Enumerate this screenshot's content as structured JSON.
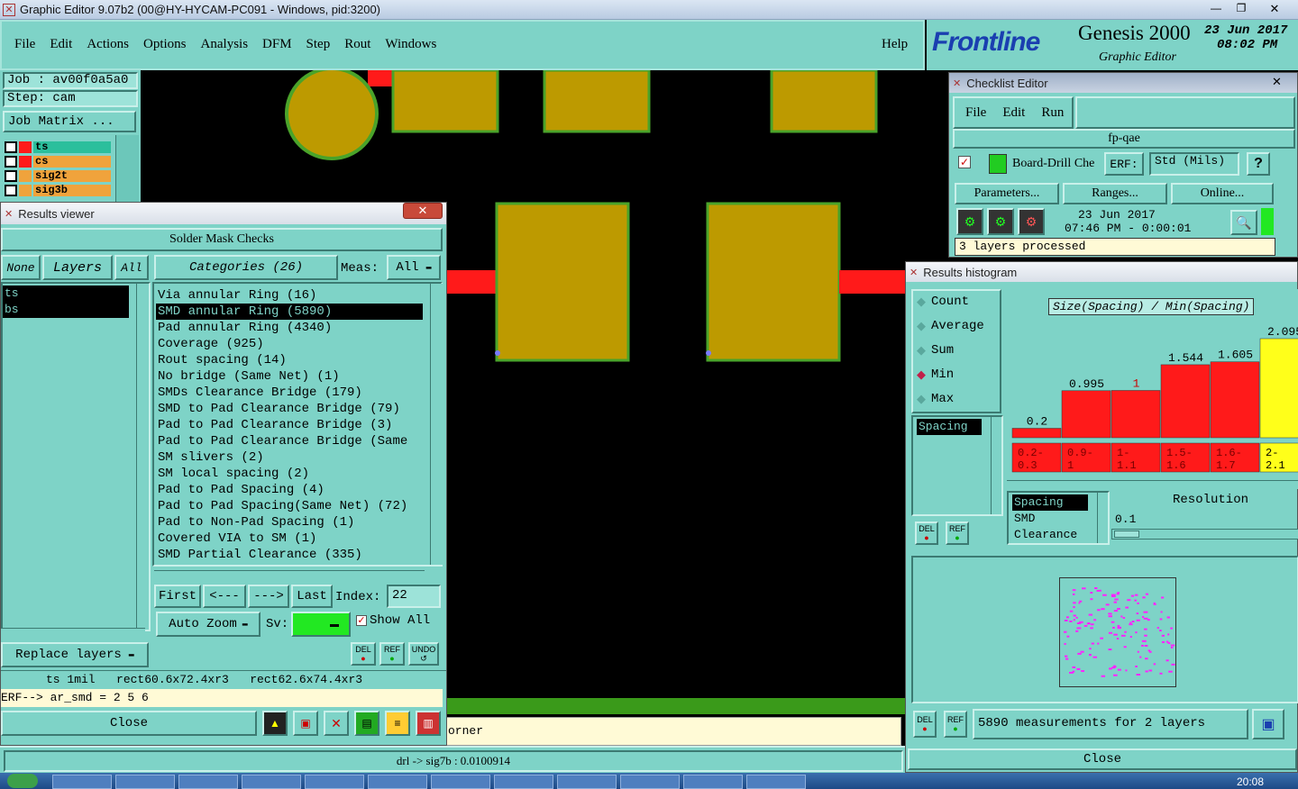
{
  "titlebar": {
    "title": "Graphic Editor 9.07b2 (00@HY-HYCAM-PC091 - Windows, pid:3200)"
  },
  "menu": {
    "items": [
      "File",
      "Edit",
      "Actions",
      "Options",
      "Analysis",
      "DFM",
      "Step",
      "Rout",
      "Windows"
    ],
    "help": "Help"
  },
  "brand": {
    "logo": "Frontline",
    "product": "Genesis 2000",
    "subtitle": "Graphic Editor",
    "date": "23 Jun 2017",
    "time": "08:02 PM"
  },
  "job": {
    "job": "Job : av00f0a5a0",
    "step": "Step: cam",
    "matrix": "Job Matrix ..."
  },
  "layers": [
    {
      "name": "ts",
      "color": "#ff1a1a",
      "bg": "#2bbf9c"
    },
    {
      "name": "cs",
      "color": "#ff1a1a",
      "bg": "#f0a33c"
    },
    {
      "name": "sig2t",
      "color": "#f0a33c",
      "bg": "#f0a33c"
    },
    {
      "name": "sig3b",
      "color": "#f0a33c",
      "bg": "#f0a33c"
    }
  ],
  "results_viewer": {
    "title": "Results viewer",
    "header": "Solder Mask Checks",
    "none": "None",
    "layers_label": "Layers",
    "all": "All",
    "layer_list": [
      "ts",
      "bs"
    ],
    "categories_label": "Categories (26)",
    "meas_label": "Meas:",
    "meas_value": "All",
    "categories": [
      "Via annular Ring (16)",
      "SMD annular Ring (5890)",
      "Pad annular Ring (4340)",
      "Coverage (925)",
      "Rout spacing (14)",
      "No bridge (Same Net) (1)",
      "SMDs Clearance Bridge (179)",
      "SMD to Pad Clearance Bridge (79)",
      "Pad to Pad Clearance Bridge (3)",
      "Pad to Pad Clearance Bridge (Same",
      "SM slivers (2)",
      "SM local spacing (2)",
      "Pad to Pad Spacing (4)",
      "Pad to Pad Spacing(Same Net) (72)",
      "Pad to Non-Pad Spacing (1)",
      "Covered VIA to SM (1)",
      "SMD Partial Clearance (335)"
    ],
    "selected_index": 1,
    "nav": {
      "first": "First",
      "prev": "<---",
      "next": "--->",
      "last": "Last",
      "index_label": "Index:",
      "index_value": "22"
    },
    "auto_zoom": "Auto Zoom",
    "sv": "Sv:",
    "show_all": "Show All",
    "replace_layers": "Replace layers",
    "del": "DEL",
    "ref": "REF",
    "undo": "UNDO",
    "info_line": "ts 1mil   rect60.6x72.4xr3   rect62.6x74.4xr3",
    "erf_line": "ERF--> ar_smd = 2 5 6",
    "close": "Close"
  },
  "canvas_status": {
    "corner": "orner",
    "bottom": "drl -> sig7b : 0.0100914"
  },
  "checklist": {
    "title": "Checklist Editor",
    "menu": [
      "File",
      "Edit",
      "Run"
    ],
    "name": "fp-qae",
    "action": "Board-Drill Che",
    "erf": "ERF:",
    "erf_value": "Std (Mils)",
    "help": "?",
    "buttons": [
      "Parameters...",
      "Ranges...",
      "Online..."
    ],
    "run_date": "23 Jun 2017",
    "run_time": "07:46 PM - 0:00:01",
    "status": "3 layers processed"
  },
  "histogram": {
    "title": "Results histogram",
    "options": [
      "Count",
      "Average",
      "Sum",
      "Min",
      "Max"
    ],
    "selected_option": "Min",
    "measure_list": [
      "Spacing"
    ],
    "chart_title": "Size(Spacing) / Min(Spacing)",
    "bars": [
      {
        "label": "0.2",
        "value": 0.2,
        "range": "0.2- 0.3",
        "color": "#ff1a1a"
      },
      {
        "label": "0.995",
        "value": 0.995,
        "range": "0.9- 1",
        "color": "#ff1a1a"
      },
      {
        "label": "1",
        "value": 1,
        "range": "1- 1.1",
        "color": "#ff1a1a"
      },
      {
        "label": "1.544",
        "value": 1.544,
        "range": "1.5- 1.6",
        "color": "#ff1a1a"
      },
      {
        "label": "1.605",
        "value": 1.605,
        "range": "1.6- 1.7",
        "color": "#ff1a1a"
      },
      {
        "label": "2.095",
        "value": 2.095,
        "range": "2- 2.1",
        "color": "#ffff1a"
      }
    ],
    "size_list": [
      "Spacing",
      "SMD",
      "Clearance"
    ],
    "resolution_label": "Resolution",
    "resolution_value": "0.1",
    "summary": "5890 measurements for 2 layers",
    "close": "Close"
  },
  "taskbar": {
    "time": "20:08"
  }
}
